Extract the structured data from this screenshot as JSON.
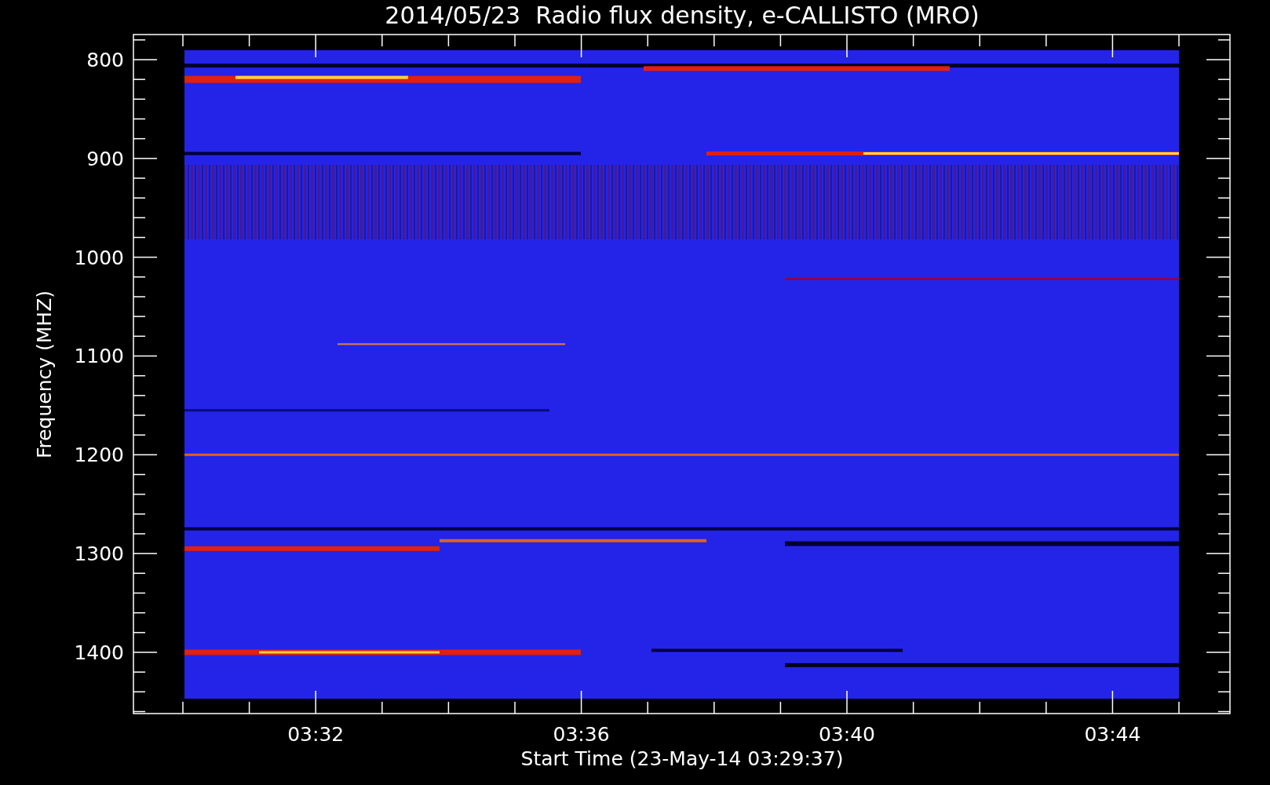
{
  "chart": {
    "title": "2014/05/23  Radio flux density, e-CALLISTO (MRO)",
    "ylabel": "Frequency (MHZ)",
    "xlabel": "Start Time (23-May-14 03:29:37)",
    "yticks": [
      "800",
      "900",
      "1000",
      "1100",
      "1200",
      "1300",
      "1400"
    ],
    "xticks": [
      "03:32",
      "03:36",
      "03:40",
      "03:44"
    ]
  }
}
